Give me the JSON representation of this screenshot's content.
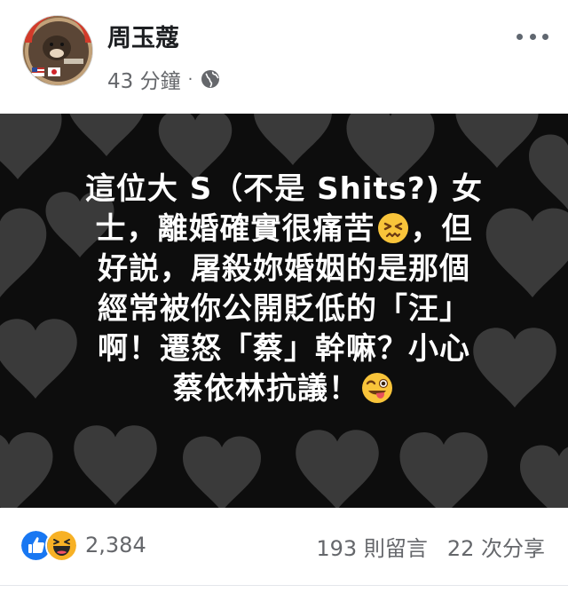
{
  "post": {
    "author": "周玉蔻",
    "timestamp": "43 分鐘",
    "separator": "·",
    "privacy_icon": "globe-icon",
    "more_icon": "more-options-icon"
  },
  "image_text": {
    "line1": "這位大 S（不是 Shits?) 女",
    "line2_a": "士，離婚確實很痛苦",
    "line2_b": "，但",
    "line3": "好説，屠殺妳婚姻的是那個",
    "line4": "經常被你公開貶低的「汪」",
    "line5": "啊！遷怒「蔡」幹嘛？小心",
    "line6": "蔡依林抗議！",
    "emoji_1": "persevering-face-emoji",
    "emoji_2": "winking-tongue-face-emoji",
    "background": "black background with gray hearts"
  },
  "footer": {
    "reaction_icons": [
      "like-icon",
      "haha-icon"
    ],
    "reaction_count": "2,384",
    "comments": "193 則留言",
    "shares": "22 次分享"
  },
  "colors": {
    "like_blue": "#1877f2",
    "haha_yellow": "#f7b125",
    "meta_gray": "#65676b",
    "image_bg": "#0d0d0d",
    "heart_gray": "#3a3a3a"
  }
}
